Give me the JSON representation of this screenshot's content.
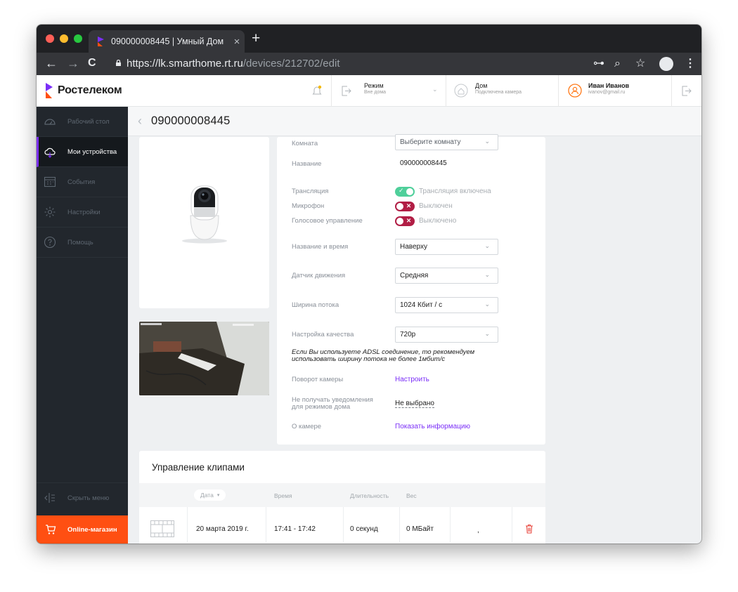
{
  "browser": {
    "tab_title": "090000008445 | Умный Дом",
    "tab_close": "×",
    "new_tab": "+",
    "url_host": "https://lk.smarthome.rt.ru",
    "url_path": "/devices/212702/edit",
    "back": "←",
    "forward": "→",
    "reload": "C",
    "key_icon": "⊶",
    "zoom_icon": "⌕",
    "star_icon": "☆",
    "menu": "⋮"
  },
  "header": {
    "brand": "Ростелеком",
    "mode_title": "Режим",
    "mode_sub": "Вне дома",
    "home_title": "Дом",
    "home_sub": "Подключена камера",
    "user_name": "Иван Иванов",
    "user_email": "ivanov@gmail.ru"
  },
  "sidebar": {
    "items": [
      {
        "label": "Рабочий стол",
        "icon": "gauge-icon"
      },
      {
        "label": "Мои устройства",
        "icon": "cloud-icon"
      },
      {
        "label": "События",
        "icon": "calendar-icon"
      },
      {
        "label": "Настройки",
        "icon": "gear-icon"
      },
      {
        "label": "Помощь",
        "icon": "help-icon"
      }
    ],
    "hide_menu": "Скрыть меню",
    "shop": "Online-магазин"
  },
  "page": {
    "title": "090000008445",
    "back": "‹"
  },
  "settings": {
    "room_label": "Комната",
    "room_value": "Выберите комнату",
    "name_label": "Название",
    "name_value": "090000008445",
    "stream_label": "Трансляция",
    "stream_state": "Трансляция включена",
    "stream_on": true,
    "mic_label": "Микрофон",
    "mic_state": "Выключен",
    "mic_on": false,
    "voice_label": "Голосовое управление",
    "voice_state": "Выключено",
    "voice_on": false,
    "name_time_label": "Название и время",
    "name_time_value": "Наверху",
    "motion_label": "Датчик движения",
    "motion_value": "Средняя",
    "bandwidth_label": "Ширина потока",
    "bandwidth_value": "1024 Кбит / с",
    "quality_label": "Настройка качества",
    "quality_value": "720р",
    "adsl_note_line1": "Если Вы используете ADSL соединение, то рекомендуем",
    "adsl_note_line2": "использовать ширину потока не более 1мбит/с",
    "rotate_label": "Поворот камеры",
    "rotate_link": "Настроить",
    "notify_label_line1": "Не получать уведомления",
    "notify_label_line2": "для режимов дома",
    "notify_value": "Не выбрано",
    "about_label": "О камере",
    "about_link": "Показать информацию"
  },
  "clips": {
    "title": "Управление клипами",
    "columns": {
      "date": "Дата",
      "time": "Время",
      "duration": "Длительность",
      "weight": "Вес"
    },
    "sort_arrow": "▾",
    "rows": [
      {
        "date": "20 марта 2019 г.",
        "time": "17:41 - 17:42",
        "duration": "0 секунд",
        "weight": "0 МБайт",
        "extra": ","
      }
    ]
  },
  "colors": {
    "accent": "#7b2ff7",
    "shop": "#ff4f12",
    "toggle_on": "#4fcf9a",
    "toggle_off": "#b11e45"
  }
}
